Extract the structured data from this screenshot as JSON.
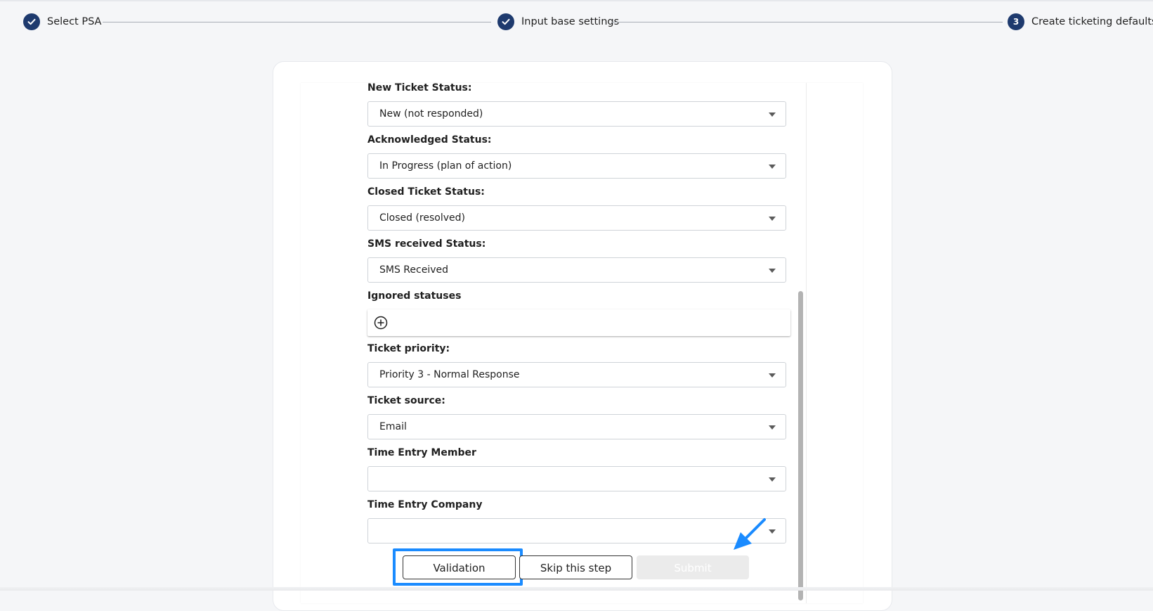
{
  "stepper": {
    "steps": [
      {
        "label": "Select PSA",
        "state": "completed",
        "marker": "check-icon"
      },
      {
        "label": "Input base settings",
        "state": "completed",
        "marker": "check-icon"
      },
      {
        "label": "Create ticketing defaults",
        "state": "active",
        "number": "3"
      }
    ]
  },
  "form": {
    "new_ticket_status": {
      "label": "New Ticket Status:",
      "value": "New (not responded)"
    },
    "acknowledged_status": {
      "label": "Acknowledged Status:",
      "value": "In Progress (plan of action)"
    },
    "closed_ticket_status": {
      "label": "Closed Ticket Status:",
      "value": "Closed (resolved)"
    },
    "sms_received_status": {
      "label": "SMS received Status:",
      "value": "SMS Received"
    },
    "ignored_statuses": {
      "label": "Ignored statuses",
      "items": []
    },
    "ticket_priority": {
      "label": "Ticket priority:",
      "value": "Priority 3 - Normal Response"
    },
    "ticket_source": {
      "label": "Ticket source:",
      "value": "Email"
    },
    "time_entry_member": {
      "label": "Time Entry Member",
      "value": ""
    },
    "time_entry_company": {
      "label": "Time Entry Company",
      "value": ""
    }
  },
  "actions": {
    "validation_label": "Validation",
    "skip_label": "Skip this step",
    "submit_label": "Submit",
    "submit_enabled": false
  },
  "colors": {
    "stepper_circle": "#1e3a6e",
    "highlight": "#1a8bff",
    "submit_disabled": "#ebebeb"
  }
}
